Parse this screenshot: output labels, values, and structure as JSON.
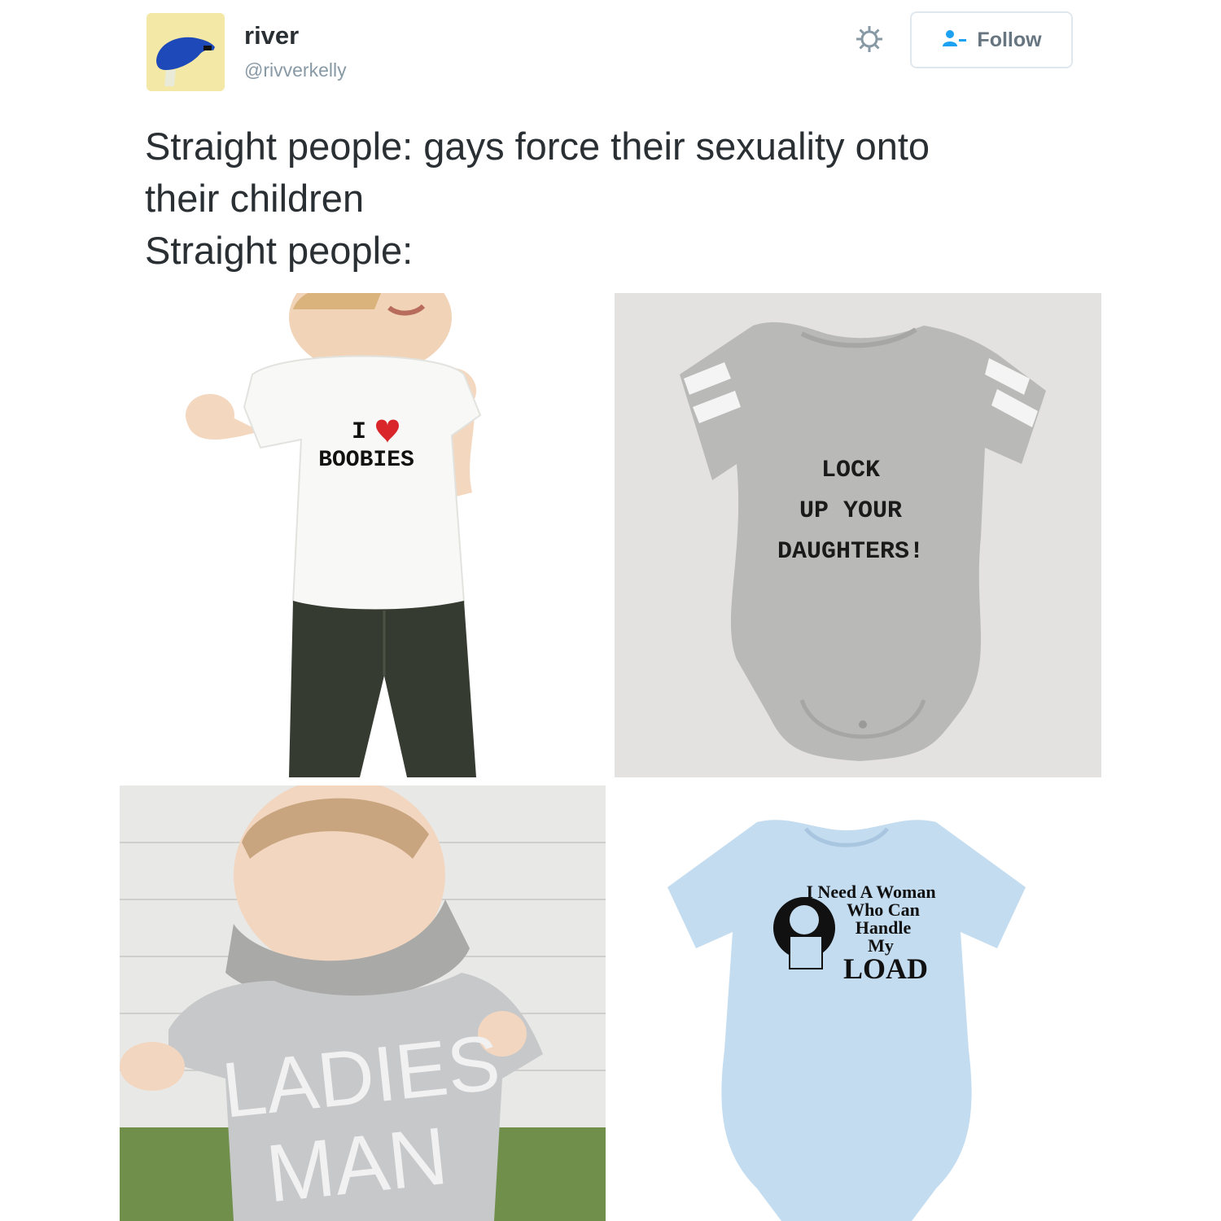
{
  "user": {
    "display_name": "river",
    "handle": "@rivverkelly"
  },
  "actions": {
    "follow_label": "Follow"
  },
  "tweet": {
    "lines": [
      "Straight people: gays force their sexuality onto",
      "their children",
      "Straight people:"
    ]
  },
  "photos": [
    {
      "shirt_text_1": "I",
      "shirt_text_2": "BOOBIES"
    },
    {
      "shirt_lines": [
        "LOCK",
        "UP YOUR",
        "DAUGHTERS!"
      ]
    },
    {
      "shirt_lines": [
        "LADIES",
        "MAN"
      ]
    },
    {
      "shirt_lines": [
        "I Need A Woman",
        "Who Can",
        "Handle",
        "My",
        "LOAD"
      ]
    }
  ],
  "colors": {
    "accent_blue_onesie": "#c4dcf0",
    "grey_onesie": "#b7b7b7",
    "heart": "#d9262b"
  }
}
